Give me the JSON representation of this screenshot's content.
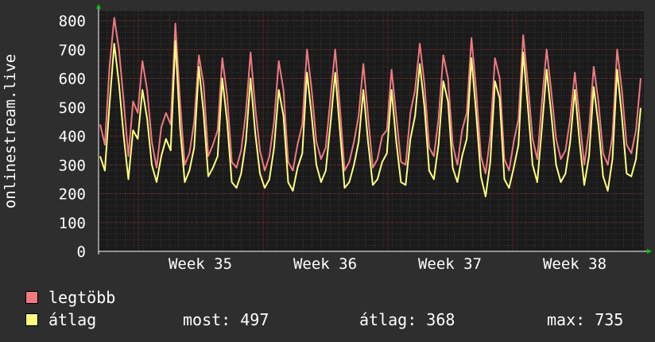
{
  "chart_data": {
    "type": "line",
    "ylabel": "onlinestream.live",
    "ylim": [
      0,
      800
    ],
    "yticks": [
      0,
      100,
      200,
      300,
      400,
      500,
      600,
      700,
      800
    ],
    "x_ticks": [
      "Week 35",
      "Week 36",
      "Week 37",
      "Week 38"
    ],
    "grid": true,
    "colors": {
      "background": "#2e2e2e",
      "plot_bg": "#1a1a1a",
      "grid_major": "#7a2a2a",
      "grid_minor": "#3c3c3c",
      "axis_arrow": "#00cc00"
    },
    "series": [
      {
        "name": "legtöbb",
        "color": "#f07a80",
        "values": [
          440,
          370,
          640,
          810,
          700,
          520,
          330,
          520,
          480,
          660,
          560,
          380,
          290,
          430,
          480,
          440,
          790,
          520,
          300,
          340,
          450,
          680,
          580,
          330,
          370,
          420,
          670,
          540,
          310,
          290,
          350,
          480,
          690,
          500,
          350,
          280,
          330,
          450,
          660,
          560,
          310,
          280,
          370,
          440,
          700,
          560,
          380,
          320,
          360,
          530,
          700,
          500,
          280,
          310,
          380,
          470,
          650,
          470,
          290,
          320,
          400,
          420,
          630,
          470,
          310,
          300,
          480,
          560,
          720,
          580,
          360,
          330,
          460,
          680,
          600,
          370,
          300,
          420,
          480,
          740,
          560,
          330,
          270,
          400,
          670,
          600,
          320,
          280,
          380,
          460,
          750,
          580,
          390,
          320,
          520,
          700,
          550,
          390,
          320,
          350,
          460,
          620,
          460,
          300,
          420,
          640,
          520,
          340,
          300,
          400,
          700,
          560,
          370,
          340,
          420,
          600
        ]
      },
      {
        "name": "átlag",
        "color": "#ffff80",
        "values": [
          330,
          280,
          510,
          720,
          580,
          400,
          250,
          420,
          390,
          560,
          460,
          300,
          240,
          330,
          390,
          350,
          730,
          430,
          240,
          280,
          360,
          640,
          480,
          260,
          290,
          330,
          600,
          450,
          240,
          220,
          270,
          380,
          600,
          410,
          270,
          220,
          250,
          360,
          560,
          470,
          240,
          210,
          290,
          340,
          620,
          470,
          300,
          240,
          280,
          440,
          620,
          420,
          220,
          240,
          300,
          380,
          560,
          380,
          230,
          250,
          310,
          340,
          560,
          380,
          240,
          230,
          390,
          470,
          650,
          500,
          280,
          250,
          370,
          590,
          520,
          290,
          240,
          330,
          390,
          670,
          480,
          260,
          190,
          310,
          590,
          530,
          250,
          220,
          290,
          370,
          690,
          500,
          300,
          240,
          430,
          630,
          470,
          300,
          240,
          270,
          380,
          560,
          380,
          230,
          330,
          570,
          440,
          260,
          210,
          320,
          630,
          470,
          270,
          260,
          320,
          497
        ]
      }
    ]
  },
  "legend": {
    "max_label": "legtöbb",
    "avg_label": "átlag",
    "now_text": "most: 497",
    "avg_text": "átlag: 368",
    "max_text": "max: 735"
  }
}
